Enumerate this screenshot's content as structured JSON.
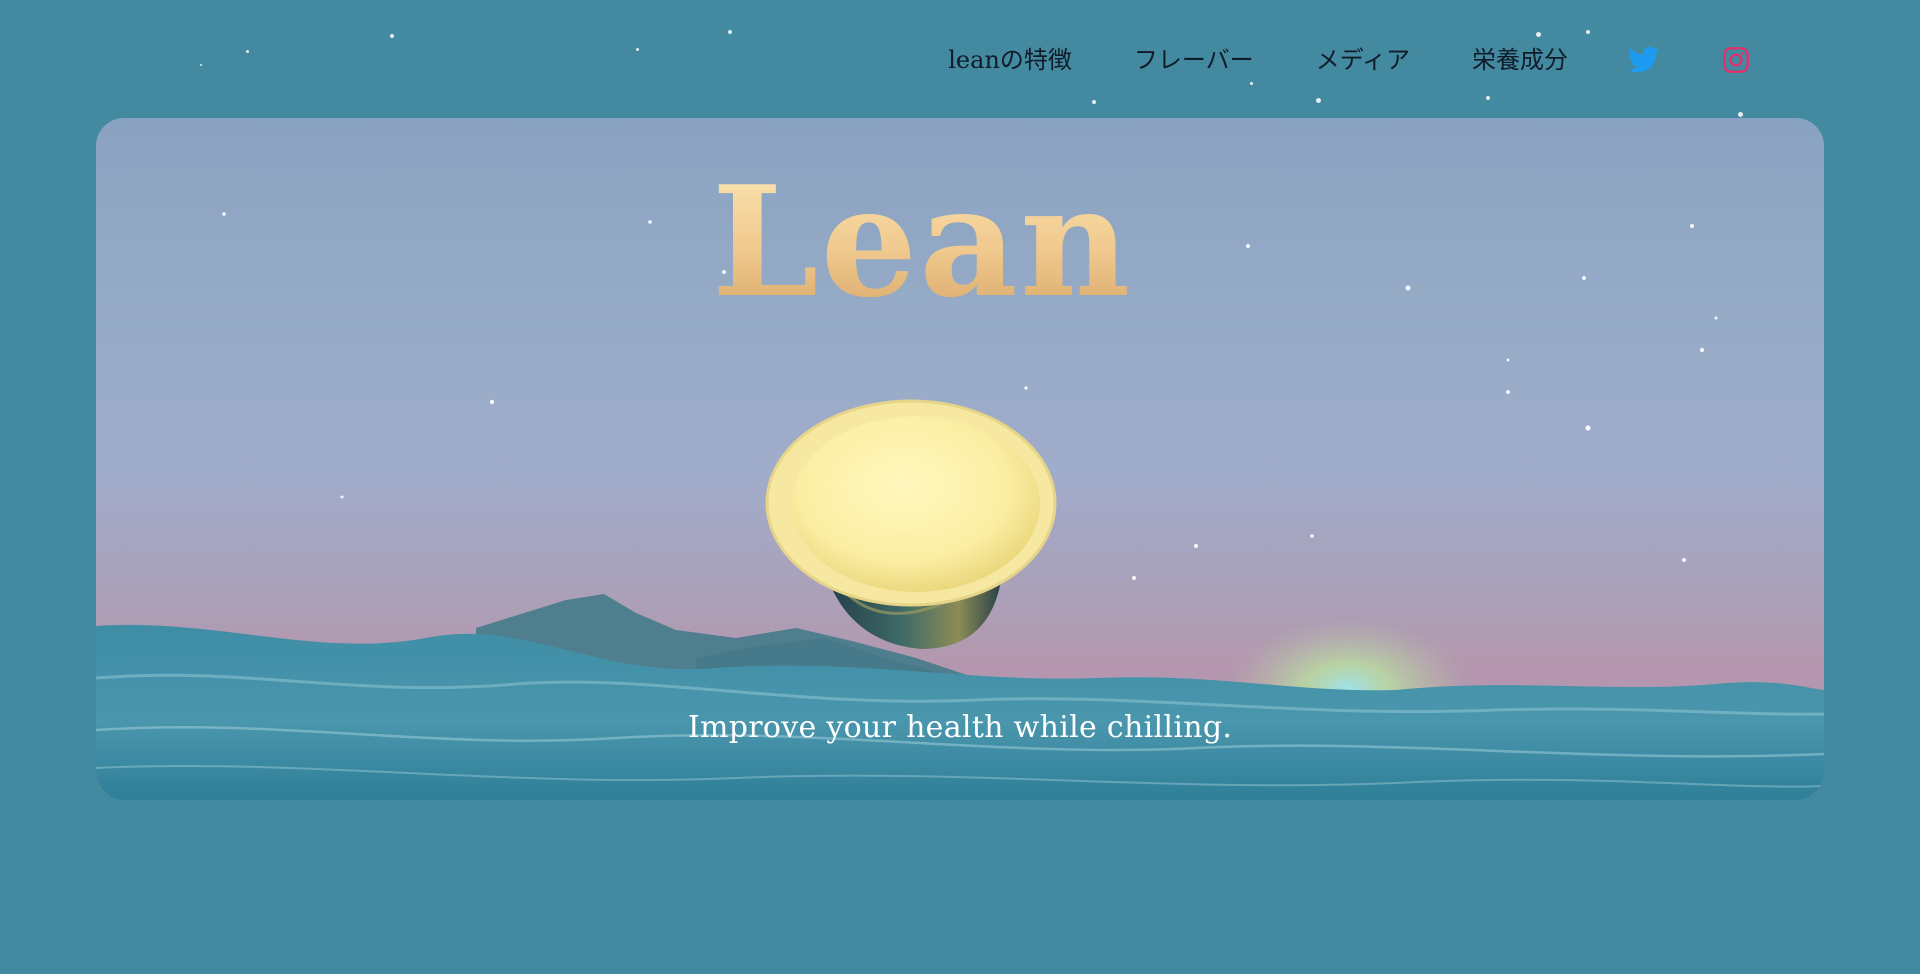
{
  "nav": {
    "items": [
      {
        "label": "leanの特徴"
      },
      {
        "label": "フレーバー"
      },
      {
        "label": "メディア"
      },
      {
        "label": "栄養成分"
      }
    ],
    "social": [
      {
        "icon": "twitter-icon",
        "color": "#1d9bf0"
      },
      {
        "icon": "instagram-icon",
        "color": "#e1306c"
      }
    ]
  },
  "hero": {
    "title": "Lean",
    "tagline": "Improve your health while chilling.",
    "product_image": "ice-cream-cup"
  },
  "colors": {
    "page_background": "#438aa1",
    "title_gold": "#f0c98e",
    "nav_text": "#101c28",
    "tagline_text": "#ffffff"
  }
}
